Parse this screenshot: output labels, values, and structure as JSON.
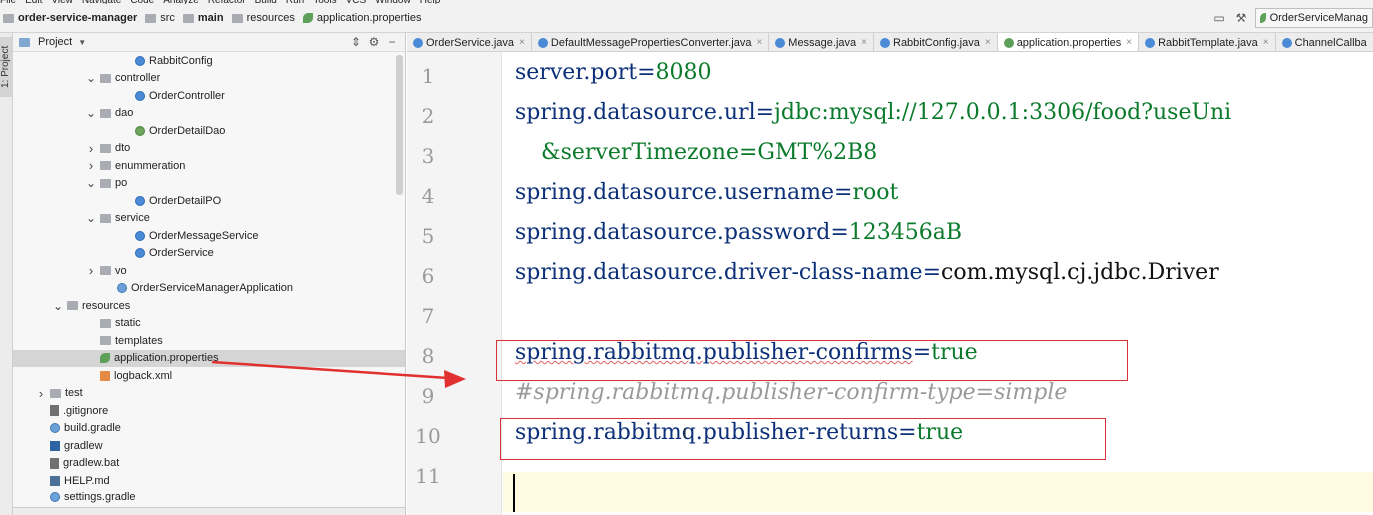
{
  "menu": [
    "File",
    "Edit",
    "View",
    "Navigate",
    "Code",
    "Analyze",
    "Refactor",
    "Build",
    "Run",
    "Tools",
    "VCS",
    "Window",
    "Help"
  ],
  "breadcrumb": {
    "project": "order-service-manager",
    "src": "src",
    "main": "main",
    "resources": "resources",
    "file": "application.properties"
  },
  "run_config": "OrderServiceManag",
  "left_strip_label": "1: Project",
  "project_panel": {
    "title": "Project",
    "tree": [
      {
        "label": "RabbitConfig",
        "icon": "class"
      },
      {
        "label": "controller",
        "icon": "folder",
        "arrow": "open"
      },
      {
        "label": "OrderController",
        "icon": "class"
      },
      {
        "label": "dao",
        "icon": "folder",
        "arrow": "open"
      },
      {
        "label": "OrderDetailDao",
        "icon": "interface"
      },
      {
        "label": "dto",
        "icon": "folder",
        "arrow": "closed"
      },
      {
        "label": "enummeration",
        "icon": "folder",
        "arrow": "closed"
      },
      {
        "label": "po",
        "icon": "folder",
        "arrow": "open"
      },
      {
        "label": "OrderDetailPO",
        "icon": "class"
      },
      {
        "label": "service",
        "icon": "folder",
        "arrow": "open"
      },
      {
        "label": "OrderMessageService",
        "icon": "class"
      },
      {
        "label": "OrderService",
        "icon": "class"
      },
      {
        "label": "vo",
        "icon": "folder",
        "arrow": "closed"
      },
      {
        "label": "OrderServiceManagerApplication",
        "icon": "spring"
      },
      {
        "label": "resources",
        "icon": "folder",
        "arrow": "open"
      },
      {
        "label": "static",
        "icon": "folder"
      },
      {
        "label": "templates",
        "icon": "folder"
      },
      {
        "label": "application.properties",
        "icon": "properties",
        "selected": true
      },
      {
        "label": "logback.xml",
        "icon": "xml"
      },
      {
        "label": "test",
        "icon": "folder",
        "arrow": "closed"
      },
      {
        "label": ".gitignore",
        "icon": "file"
      },
      {
        "label": "build.gradle",
        "icon": "gradle"
      },
      {
        "label": "gradlew",
        "icon": "shell"
      },
      {
        "label": "gradlew.bat",
        "icon": "file"
      },
      {
        "label": "HELP.md",
        "icon": "markdown"
      },
      {
        "label": "settings.gradle",
        "icon": "gradle"
      }
    ]
  },
  "tabs": [
    {
      "label": "OrderService.java",
      "icon": "class"
    },
    {
      "label": "DefaultMessagePropertiesConverter.java",
      "icon": "class"
    },
    {
      "label": "Message.java",
      "icon": "class"
    },
    {
      "label": "RabbitConfig.java",
      "icon": "class"
    },
    {
      "label": "application.properties",
      "icon": "properties",
      "active": true
    },
    {
      "label": "RabbitTemplate.java",
      "icon": "class"
    },
    {
      "label": "ChannelCallba",
      "icon": "class"
    }
  ],
  "line_numbers": [
    "1",
    "2",
    "3",
    "4",
    "5",
    "6",
    "7",
    "8",
    "9",
    "10",
    "11"
  ],
  "code": {
    "l1k": "server.port",
    "l1v": "8080",
    "l2k": "spring.datasource.url",
    "l2v": "jdbc:mysql://127.0.0.1:3306/food?useUni",
    "l3v": "&serverTimezone=GMT%2B8",
    "l4k": "spring.datasource.username",
    "l4v": "root",
    "l5k": "spring.datasource.password",
    "l5v": "123456aB",
    "l6k": "spring.datasource.driver-class-name",
    "l6v": "com.mysql.cj.jdbc.Driver",
    "l8k": "spring.rabbitmq.publisher-confirms",
    "l8v": "true",
    "l9c": "#spring.rabbitmq.publisher-confirm-type=simple",
    "l10k": "spring.rabbitmq.publisher-returns",
    "l10v": "true",
    "eq": "="
  },
  "colors": {
    "highlight": "#d9303a",
    "key": "#0b2f78",
    "value": "#0a7a2a"
  }
}
